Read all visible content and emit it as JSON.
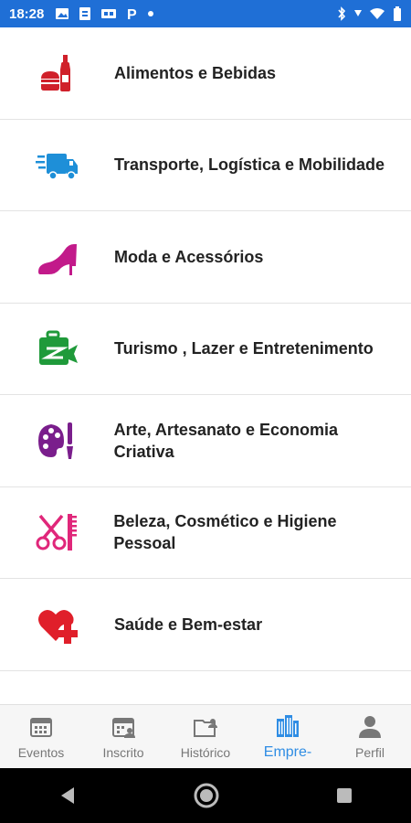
{
  "status_bar": {
    "time": "18:28"
  },
  "categories": [
    {
      "label": "Alimentos e Bebidas",
      "icon": "food-drinks-icon",
      "color": "#d0202a"
    },
    {
      "label": "Transporte, Logística e Mobilidade",
      "icon": "delivery-truck-icon",
      "color": "#1e8fd8"
    },
    {
      "label": "Moda e Acessórios",
      "icon": "high-heel-icon",
      "color": "#c21a8a"
    },
    {
      "label": "Turismo , Lazer e Entretenimento",
      "icon": "travel-icon",
      "color": "#1f9a3a"
    },
    {
      "label": "Arte, Artesanato e Economia Criativa",
      "icon": "art-palette-icon",
      "color": "#7a1e8c"
    },
    {
      "label": "Beleza, Cosmético e Higiene Pessoal",
      "icon": "scissors-comb-icon",
      "color": "#e0277a"
    },
    {
      "label": "Saúde e Bem-estar",
      "icon": "heart-health-icon",
      "color": "#e01f2a"
    }
  ],
  "bottom_nav": {
    "items": [
      {
        "label": "Eventos",
        "icon": "calendar-icon"
      },
      {
        "label": "Inscrito",
        "icon": "calendar-user-icon"
      },
      {
        "label": "Histórico",
        "icon": "folder-user-icon"
      },
      {
        "label": "Empre-",
        "icon": "buildings-icon",
        "active": true
      },
      {
        "label": "Perfil",
        "icon": "person-icon"
      }
    ]
  },
  "accent_color": "#2f8de4"
}
